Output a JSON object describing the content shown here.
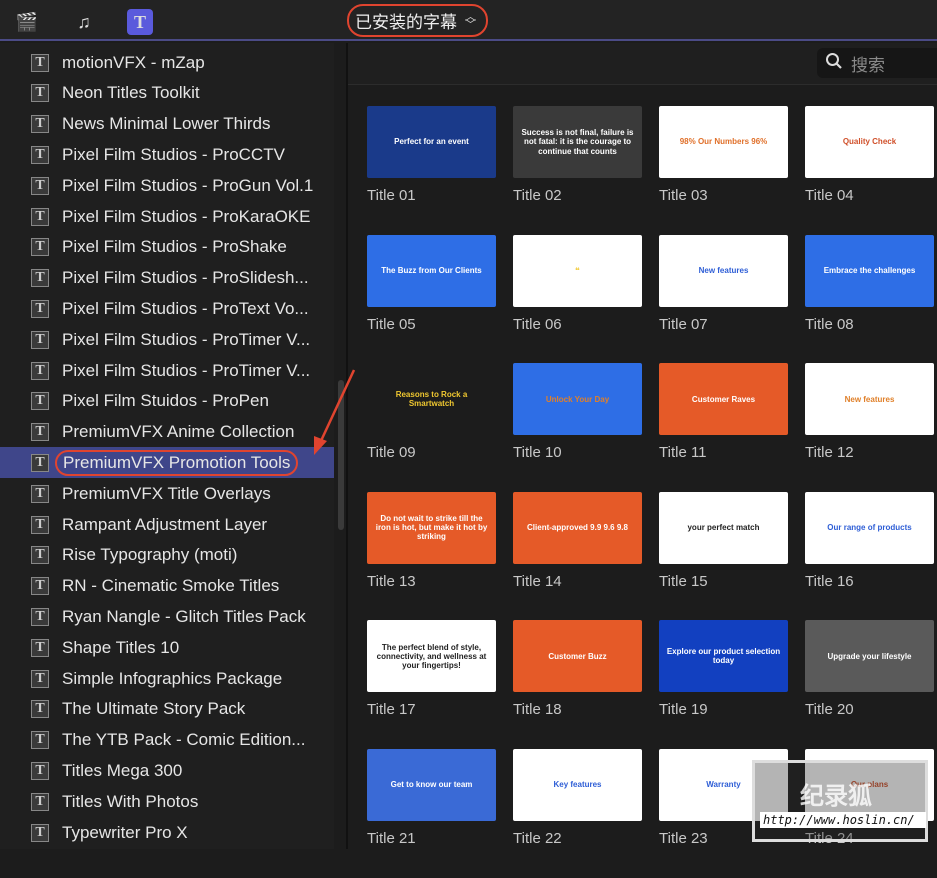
{
  "toolbar": {
    "icons": [
      "clapper-star-icon",
      "music-photo-icon",
      "titles-icon"
    ],
    "library_picker": "已安装的字幕",
    "picker_chevron": "⌃⌄"
  },
  "search": {
    "placeholder": "搜索"
  },
  "sidebar": {
    "items": [
      "motionVFX - mZap",
      "Neon Titles Toolkit",
      "News Minimal Lower Thirds",
      "Pixel Film Studios - ProCCTV",
      "Pixel Film Studios - ProGun Vol.1",
      "Pixel Film Studios - ProKaraOKE",
      "Pixel Film Studios - ProShake",
      "Pixel Film Studios - ProSlidesh...",
      "Pixel Film Studios - ProText Vo...",
      "Pixel Film Studios - ProTimer V...",
      "Pixel Film Studios - ProTimer V...",
      "Pixel Film Stuidos - ProPen",
      "PremiumVFX Anime Collection",
      "PremiumVFX Promotion Tools",
      "PremiumVFX Title Overlays",
      "Rampant Adjustment Layer",
      "Rise Typography (moti)",
      "RN - Cinematic Smoke Titles",
      "Ryan Nangle - Glitch Titles Pack",
      "Shape Titles 10",
      "Simple Infographics Package",
      "The Ultimate Story Pack",
      "The YTB Pack - Comic Edition...",
      "Titles Mega 300",
      "Titles With Photos",
      "Typewriter Pro X"
    ],
    "selected_index": 13,
    "item_icon": "T"
  },
  "titles": [
    {
      "label": "Title 01",
      "text": "Perfect for an event",
      "bg": "#1a3a8a",
      "fg": "#ffffff"
    },
    {
      "label": "Title 02",
      "text": "Success is not final, failure is not fatal: it is the courage to continue that counts",
      "bg": "#3a3a3a",
      "fg": "#ffffff"
    },
    {
      "label": "Title 03",
      "text": "98%  Our Numbers  96%",
      "bg": "#ffffff",
      "fg": "#e0702a"
    },
    {
      "label": "Title 04",
      "text": "Quality Check",
      "bg": "#ffffff",
      "fg": "#d0502a"
    },
    {
      "label": "Title 05",
      "text": "The Buzz from Our Clients",
      "bg": "#2e6ee6",
      "fg": "#ffffff"
    },
    {
      "label": "Title 06",
      "text": "❝ ",
      "bg": "#ffffff",
      "fg": "#f0c830"
    },
    {
      "label": "Title 07",
      "text": "New features",
      "bg": "#ffffff",
      "fg": "#2e5ed6"
    },
    {
      "label": "Title 08",
      "text": "Embrace the challenges",
      "bg": "#2e6ee6",
      "fg": "#ffffff"
    },
    {
      "label": "Title 09",
      "text": "Reasons to Rock a Smartwatch",
      "bg": "#1c1c1c",
      "fg": "#f0c830"
    },
    {
      "label": "Title 10",
      "text": "Unlock Your Day",
      "bg": "#2e6ee6",
      "fg": "#e0802a"
    },
    {
      "label": "Title 11",
      "text": "Customer Raves",
      "bg": "#e55a28",
      "fg": "#ffffff"
    },
    {
      "label": "Title 12",
      "text": "New features",
      "bg": "#ffffff",
      "fg": "#e0802a"
    },
    {
      "label": "Title 13",
      "text": "Do not wait to strike till the iron is hot, but make it hot by striking",
      "bg": "#e55a28",
      "fg": "#ffffff"
    },
    {
      "label": "Title 14",
      "text": "Client-approved 9.9 9.6 9.8",
      "bg": "#e55a28",
      "fg": "#ffffff"
    },
    {
      "label": "Title 15",
      "text": "your perfect match",
      "bg": "#ffffff",
      "fg": "#222222"
    },
    {
      "label": "Title 16",
      "text": "Our range of products",
      "bg": "#ffffff",
      "fg": "#2e5ed6"
    },
    {
      "label": "Title 17",
      "text": "The perfect blend of style, connectivity, and wellness at your fingertips!",
      "bg": "#ffffff",
      "fg": "#222222"
    },
    {
      "label": "Title 18",
      "text": "Customer Buzz",
      "bg": "#e55a28",
      "fg": "#ffffff"
    },
    {
      "label": "Title 19",
      "text": "Explore our product selection today",
      "bg": "#1240c0",
      "fg": "#ffffff"
    },
    {
      "label": "Title 20",
      "text": "Upgrade your lifestyle",
      "bg": "#5a5a5a",
      "fg": "#ffffff"
    },
    {
      "label": "Title 21",
      "text": "Get to know our team",
      "bg": "#3a6ad6",
      "fg": "#ffffff"
    },
    {
      "label": "Title 22",
      "text": "Key features",
      "bg": "#ffffff",
      "fg": "#2e5ed6"
    },
    {
      "label": "Title 23",
      "text": "Warranty",
      "bg": "#ffffff",
      "fg": "#2e5ed6"
    },
    {
      "label": "Title 24",
      "text": "Our plans",
      "bg": "#ffffff",
      "fg": "#d0502a"
    }
  ],
  "watermark": {
    "logo": "纪录狐",
    "url": "http://www.hoslin.cn/"
  },
  "colors": {
    "accent": "#e0442f",
    "selection": "#3f468a"
  }
}
